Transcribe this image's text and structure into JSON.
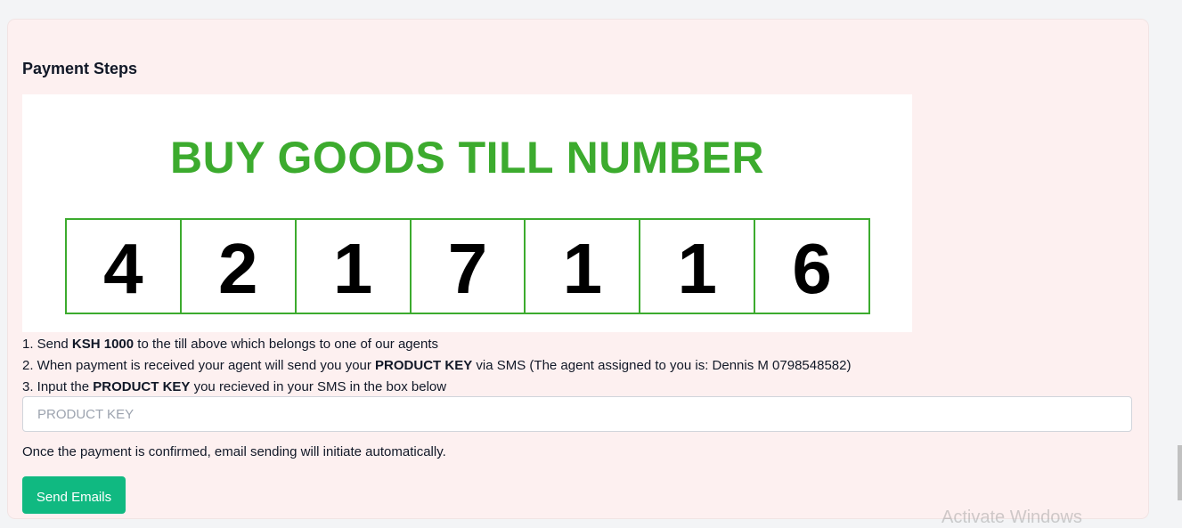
{
  "page": {
    "title": "Payment Steps"
  },
  "till": {
    "heading": "BUY GOODS TILL NUMBER",
    "digits": [
      "4",
      "2",
      "1",
      "7",
      "1",
      "1",
      "6"
    ],
    "accent_color": "#3cab2e"
  },
  "steps": {
    "step1": {
      "prefix": "1. Send ",
      "bold": "KSH 1000",
      "suffix": " to the till above which belongs to one of our agents"
    },
    "step2": {
      "prefix": "2. When payment is received your agent will send you your ",
      "bold": "PRODUCT KEY",
      "suffix": " via SMS (The agent assigned to you is: Dennis M 0798548582)"
    },
    "step3": {
      "prefix": "3. Input the ",
      "bold": "PRODUCT KEY",
      "suffix": " you recieved in your SMS in the box below"
    }
  },
  "product_key": {
    "value": "",
    "placeholder": "PRODUCT KEY"
  },
  "note": "Once the payment is confirmed, email sending will initiate automatically.",
  "send_button": {
    "label": "Send Emails",
    "color": "#10b981"
  },
  "watermark": "Activate Windows"
}
